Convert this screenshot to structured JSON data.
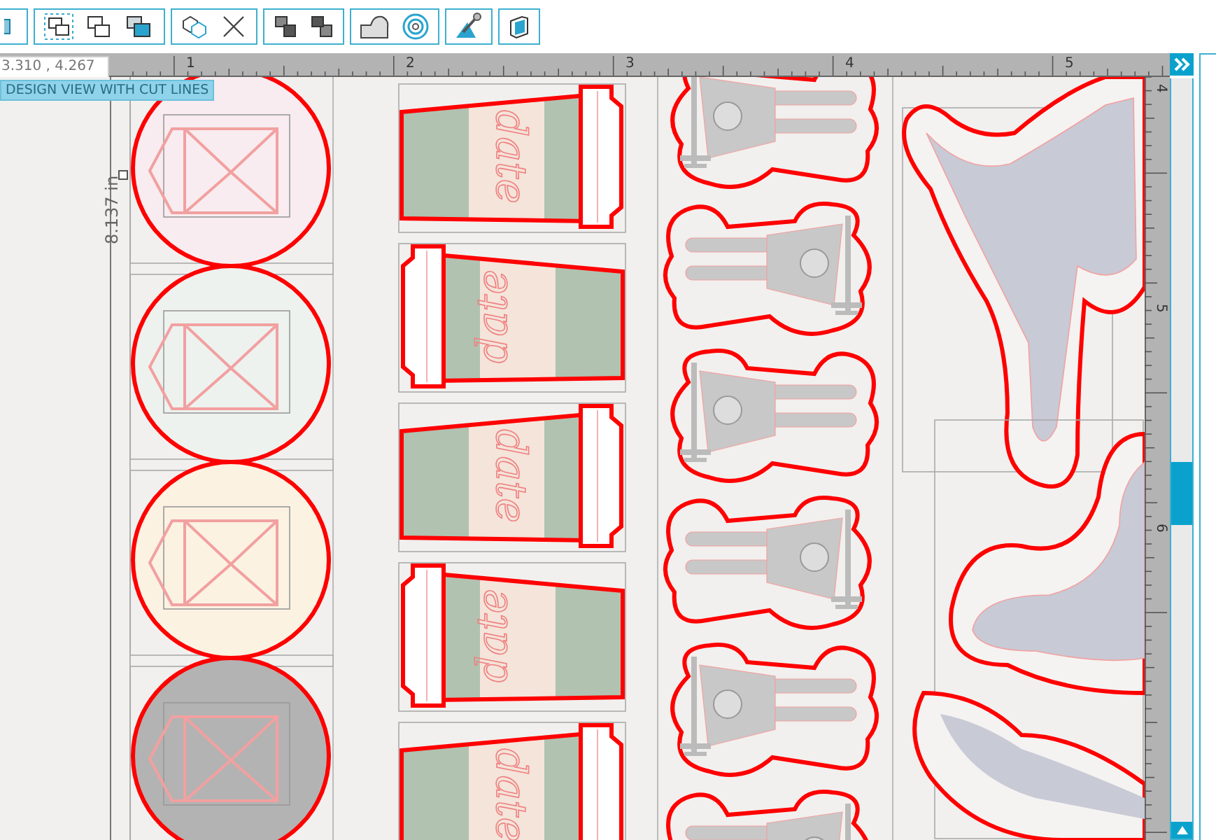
{
  "coordinates": "3.310 , 4.267",
  "view_label": "DESIGN VIEW WITH CUT LINES",
  "dimension": "8.137 in",
  "top_ruler": {
    "numbers": [
      "1",
      "2",
      "3",
      "4",
      "5"
    ]
  },
  "side_ruler": {
    "numbers": [
      "4",
      "5",
      "6"
    ]
  },
  "circle_stickers": [
    {
      "color": "#f8ecf0"
    },
    {
      "color": "#edf2ef"
    },
    {
      "color": "#fbf2e2"
    },
    {
      "color": "#b4b3b3"
    }
  ],
  "cup_stickers": [
    {
      "label": "date",
      "flipped": false
    },
    {
      "label": "date",
      "flipped": true
    },
    {
      "label": "date",
      "flipped": false
    },
    {
      "label": "date",
      "flipped": true
    },
    {
      "label": "date",
      "flipped": false
    }
  ],
  "figure_stickers": [
    {
      "flipped": false
    },
    {
      "flipped": true
    },
    {
      "flipped": false
    },
    {
      "flipped": true
    },
    {
      "flipped": false
    },
    {
      "flipped": true
    }
  ]
}
